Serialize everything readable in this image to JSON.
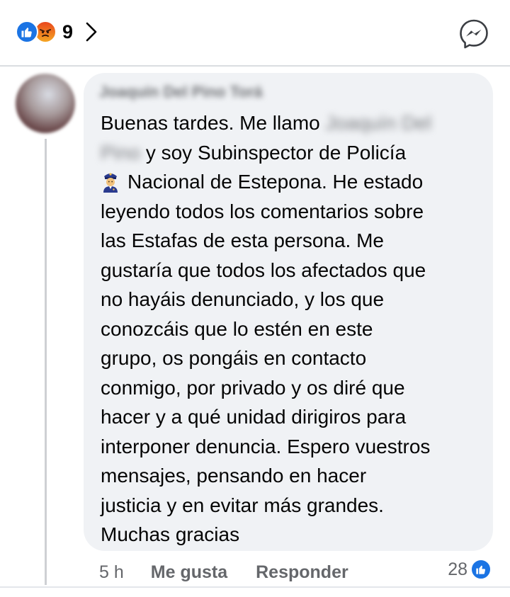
{
  "top_bar": {
    "reaction_count": "9",
    "reactions": [
      "like-icon",
      "angry-icon"
    ]
  },
  "comment": {
    "author": "Joaquín Del Pino Torá",
    "lines": [
      {
        "pre": "Buenas tardes. Me llamo ",
        "blur": "Joaquín Del",
        "post": ""
      },
      {
        "pre": "",
        "blur": "Pino",
        "post": " y soy Subinspector de Policía"
      },
      {
        "emoji": "police-officer-icon",
        "pre": "Nacional de Estepona. He estado"
      },
      {
        "pre": "leyendo todos los comentarios sobre"
      },
      {
        "pre": "las Estafas de esta persona. Me"
      },
      {
        "pre": "gustaría que todos los afectados que"
      },
      {
        "pre": "no hayáis denunciado, y los que"
      },
      {
        "pre": "conozcáis que lo estén en este"
      },
      {
        "pre": "grupo, os pongáis en contacto"
      },
      {
        "pre": "conmigo, por privado y os diré que"
      },
      {
        "pre": "hacer y a qué unidad dirigiros para"
      },
      {
        "pre": "interponer denuncia. Espero vuestros"
      },
      {
        "pre": "mensajes, pensando en hacer"
      },
      {
        "pre": "justicia y en evitar más grandes."
      },
      {
        "pre": "Muchas gracias"
      }
    ],
    "time": "5 h",
    "like_label": "Me gusta",
    "reply_label": "Responder",
    "reaction_count": "28"
  },
  "colors": {
    "like_blue": "#1b74e4",
    "bubble_bg": "#f0f2f5",
    "meta_text": "#65676b"
  }
}
